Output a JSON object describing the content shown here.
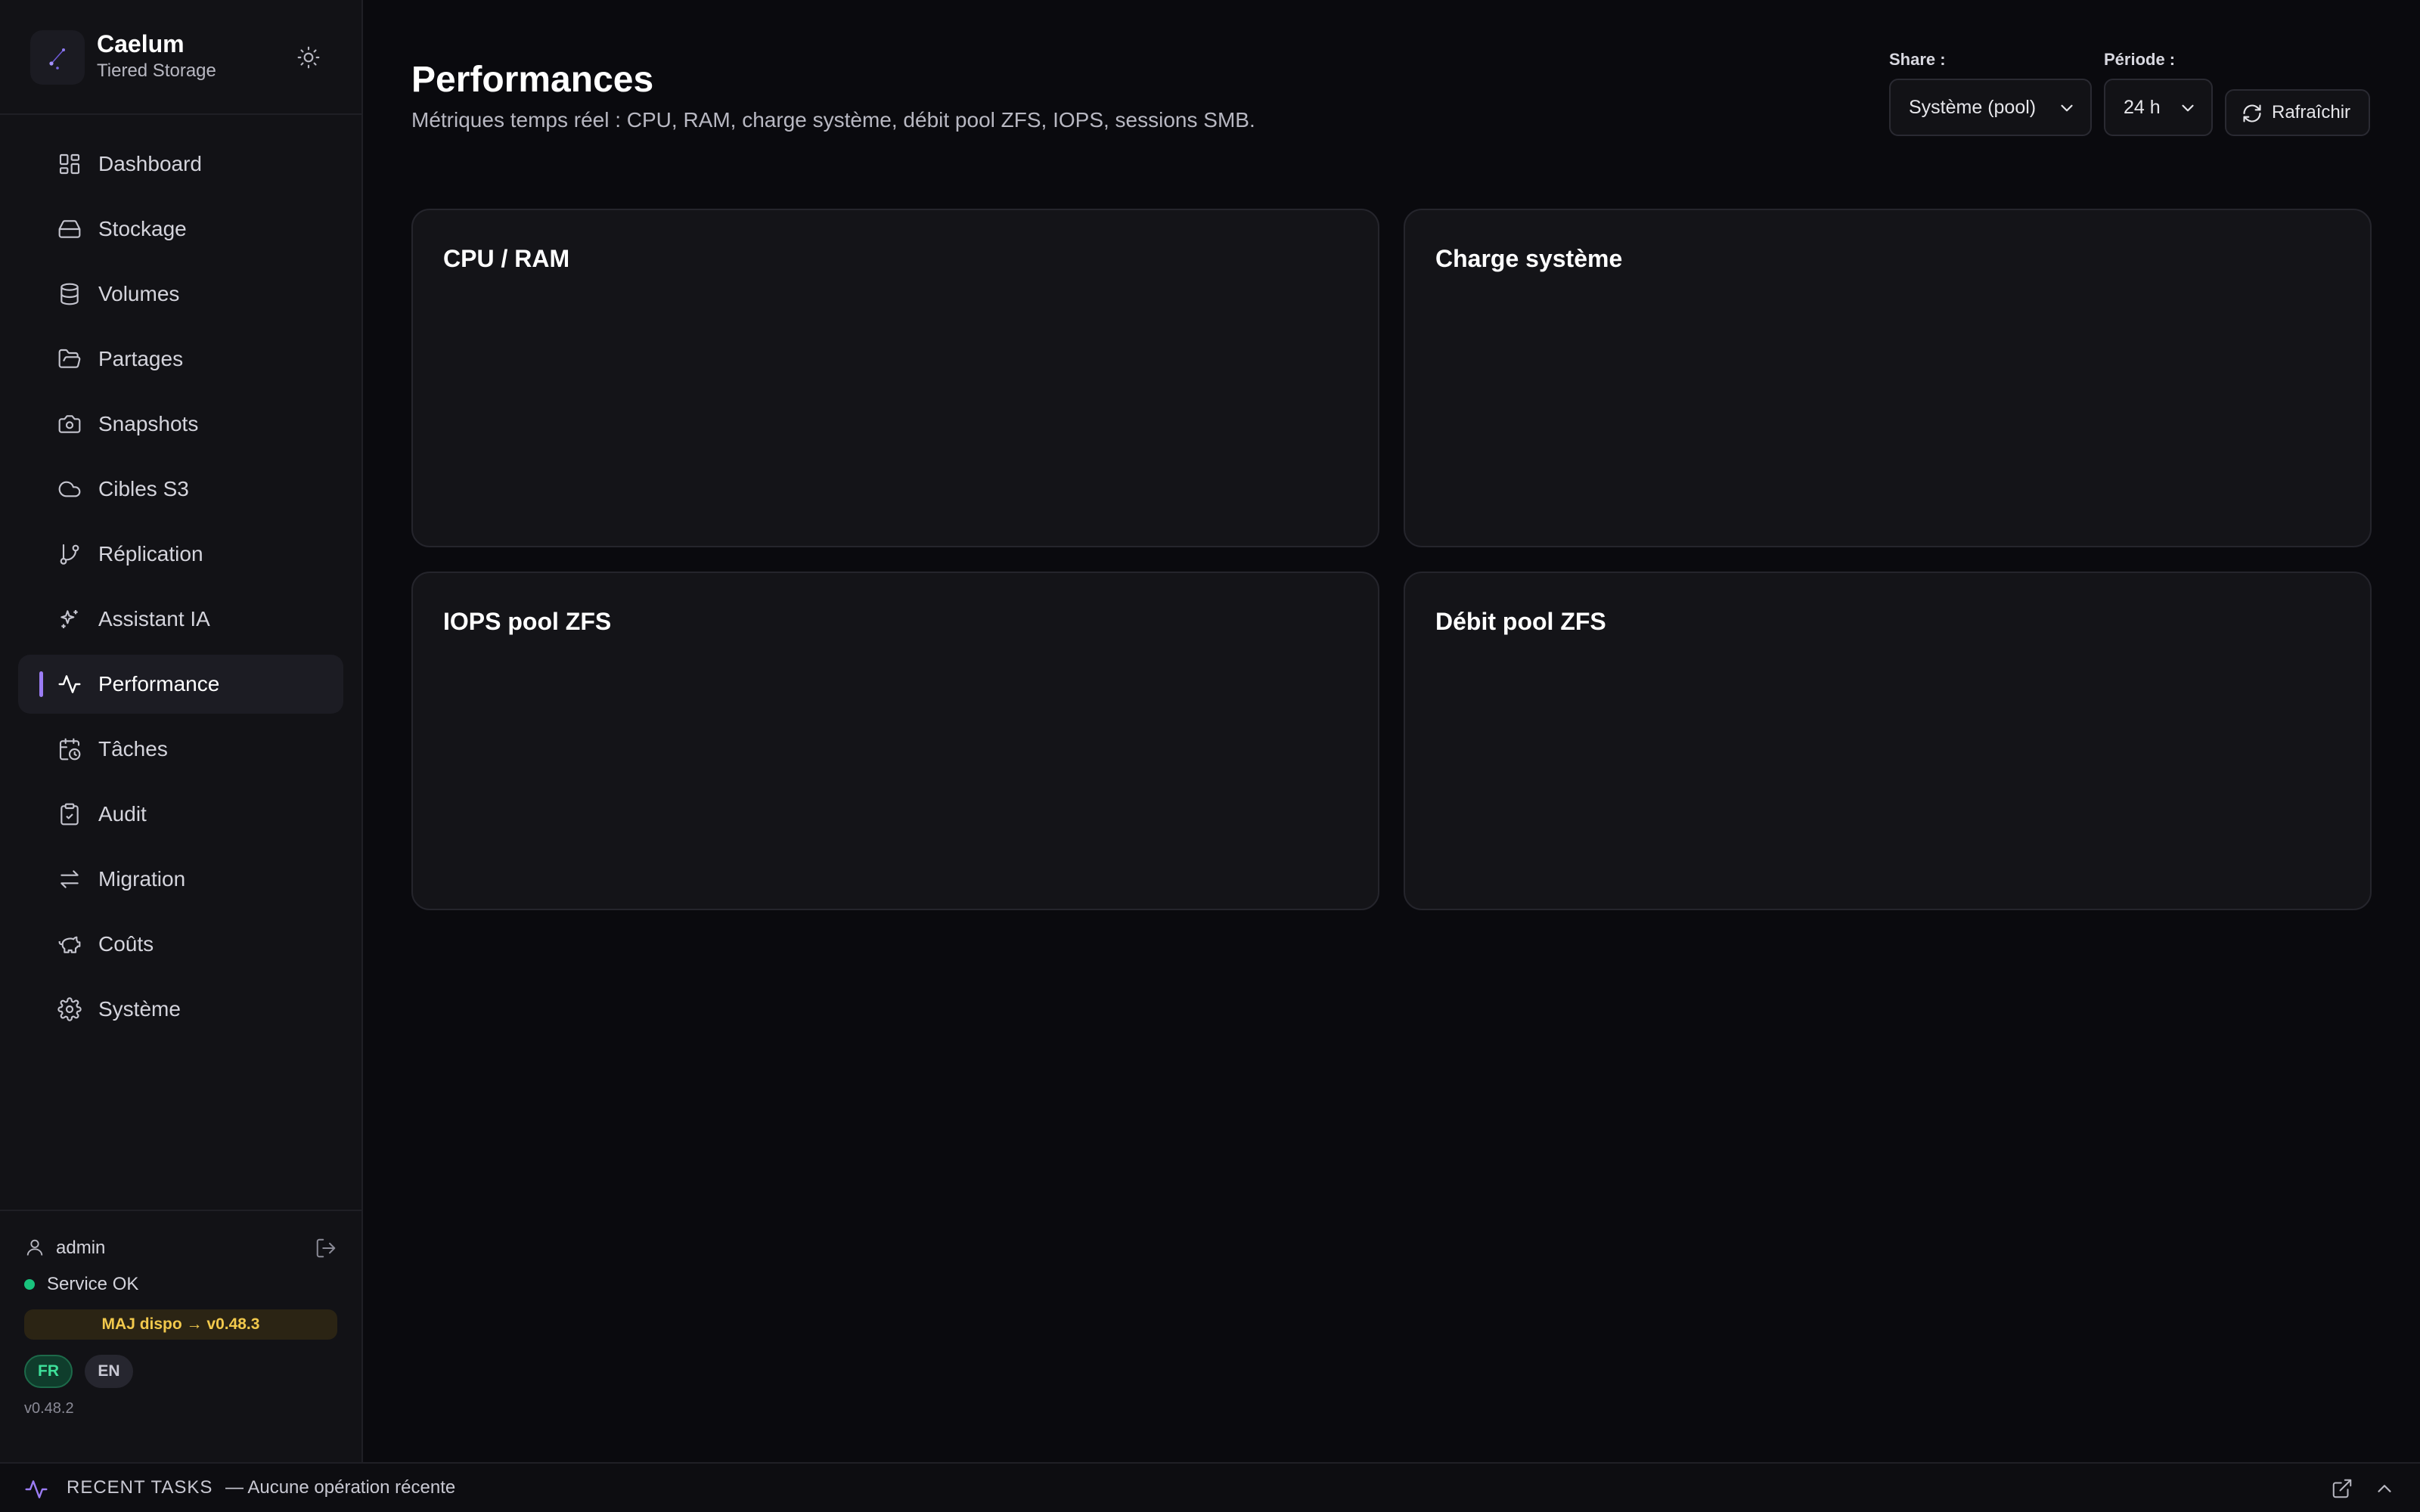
{
  "brand": {
    "name": "Caelum",
    "subtitle": "Tiered Storage"
  },
  "nav": [
    {
      "id": "dashboard",
      "label": "Dashboard",
      "icon": "dashboard-icon"
    },
    {
      "id": "stockage",
      "label": "Stockage",
      "icon": "hard-drive-icon"
    },
    {
      "id": "volumes",
      "label": "Volumes",
      "icon": "database-icon"
    },
    {
      "id": "partages",
      "label": "Partages",
      "icon": "folder-open-icon"
    },
    {
      "id": "snapshots",
      "label": "Snapshots",
      "icon": "camera-icon"
    },
    {
      "id": "cibles-s3",
      "label": "Cibles S3",
      "icon": "cloud-icon"
    },
    {
      "id": "replication",
      "label": "Réplication",
      "icon": "git-branch-icon"
    },
    {
      "id": "assistant-ia",
      "label": "Assistant IA",
      "icon": "sparkles-icon"
    },
    {
      "id": "performance",
      "label": "Performance",
      "icon": "activity-icon",
      "active": true
    },
    {
      "id": "taches",
      "label": "Tâches",
      "icon": "calendar-clock-icon"
    },
    {
      "id": "audit",
      "label": "Audit",
      "icon": "clipboard-check-icon"
    },
    {
      "id": "migration",
      "label": "Migration",
      "icon": "arrows-swap-icon"
    },
    {
      "id": "couts",
      "label": "Coûts",
      "icon": "piggy-bank-icon"
    },
    {
      "id": "systeme",
      "label": "Système",
      "icon": "gear-icon"
    }
  ],
  "footer": {
    "user": "admin",
    "status": "Service OK",
    "update": "MAJ dispo → v0.48.3",
    "lang_fr": "FR",
    "lang_en": "EN",
    "version": "v0.48.2"
  },
  "page": {
    "title": "Performances",
    "subtitle": "Métriques temps réel : CPU, RAM, charge système, débit pool ZFS, IOPS, sessions SMB."
  },
  "controls": {
    "share_label": "Share :",
    "share_value": "Système (pool)",
    "period_label": "Période :",
    "period_value": "24 h",
    "refresh_label": "Rafraîchir"
  },
  "cards": {
    "cpu_ram": "CPU / RAM",
    "load": "Charge système",
    "iops": "IOPS pool ZFS",
    "throughput": "Débit pool ZFS"
  },
  "taskbar": {
    "title": "RECENT TASKS",
    "message": "— Aucune opération récente"
  },
  "colors": {
    "accent": "#9b7cf4",
    "status_ok": "#19c37d",
    "update": "#f2c94c"
  }
}
